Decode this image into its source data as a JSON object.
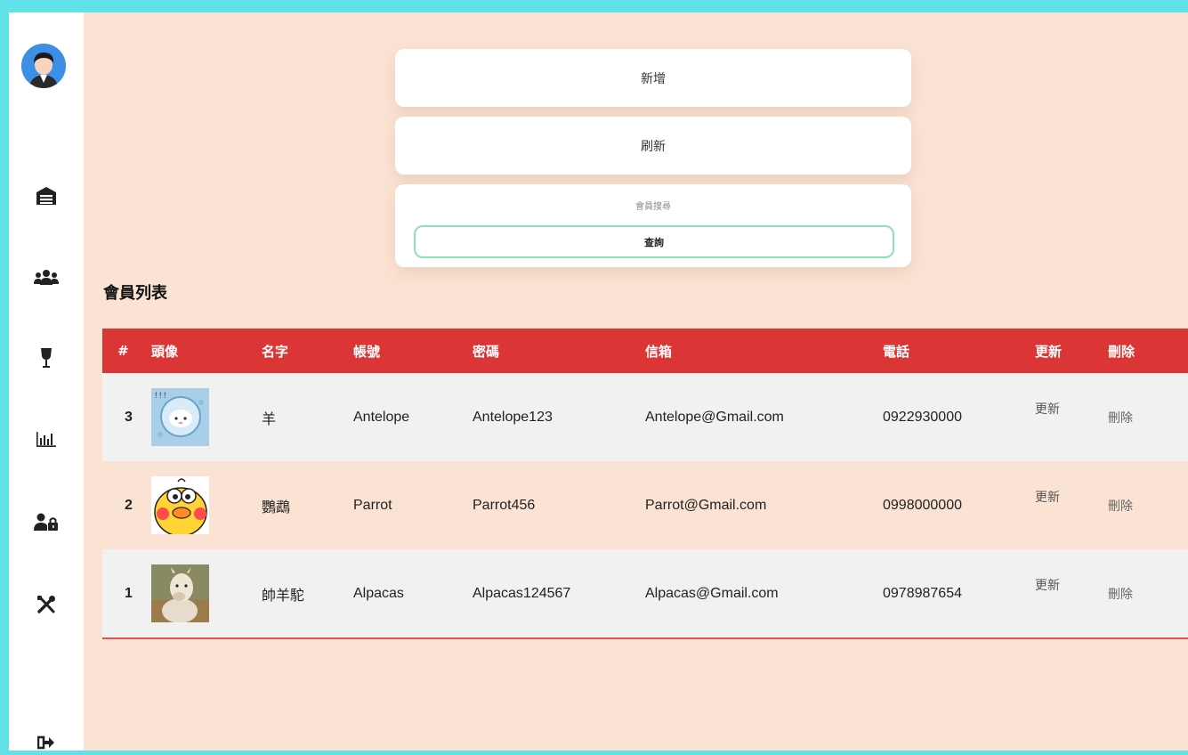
{
  "sidebar": {
    "icons": [
      "user-avatar",
      "warehouse-icon",
      "users-icon",
      "wine-glass-icon",
      "bar-chart-icon",
      "user-lock-icon",
      "tools-icon",
      "sign-out-icon"
    ]
  },
  "actions": {
    "add_label": "新增",
    "refresh_label": "刷新",
    "search_label": "會員搜尋",
    "query_label": "查詢"
  },
  "member_list": {
    "title": "會員列表",
    "columns": [
      "#",
      "頭像",
      "名字",
      "帳號",
      "密碼",
      "信箱",
      "電話",
      "更新",
      "刪除"
    ],
    "rows": [
      {
        "id": "3",
        "name": "羊",
        "account": "Antelope",
        "password": "Antelope123",
        "email": "Antelope@Gmail.com",
        "phone": "0922930000",
        "update": "更新",
        "delete": "刪除"
      },
      {
        "id": "2",
        "name": "鸚鵡",
        "account": "Parrot",
        "password": "Parrot456",
        "email": "Parrot@Gmail.com",
        "phone": "0998000000",
        "update": "更新",
        "delete": "刪除"
      },
      {
        "id": "1",
        "name": "帥羊駝",
        "account": "Alpacas",
        "password": "Alpacas124567",
        "email": "Alpacas@Gmail.com",
        "phone": "0978987654",
        "update": "更新",
        "delete": "刪除"
      }
    ]
  },
  "colors": {
    "frame": "#60e2e8",
    "background": "#fbe3d3",
    "table_header": "#dc3535",
    "query_border": "#8fe0b6"
  }
}
